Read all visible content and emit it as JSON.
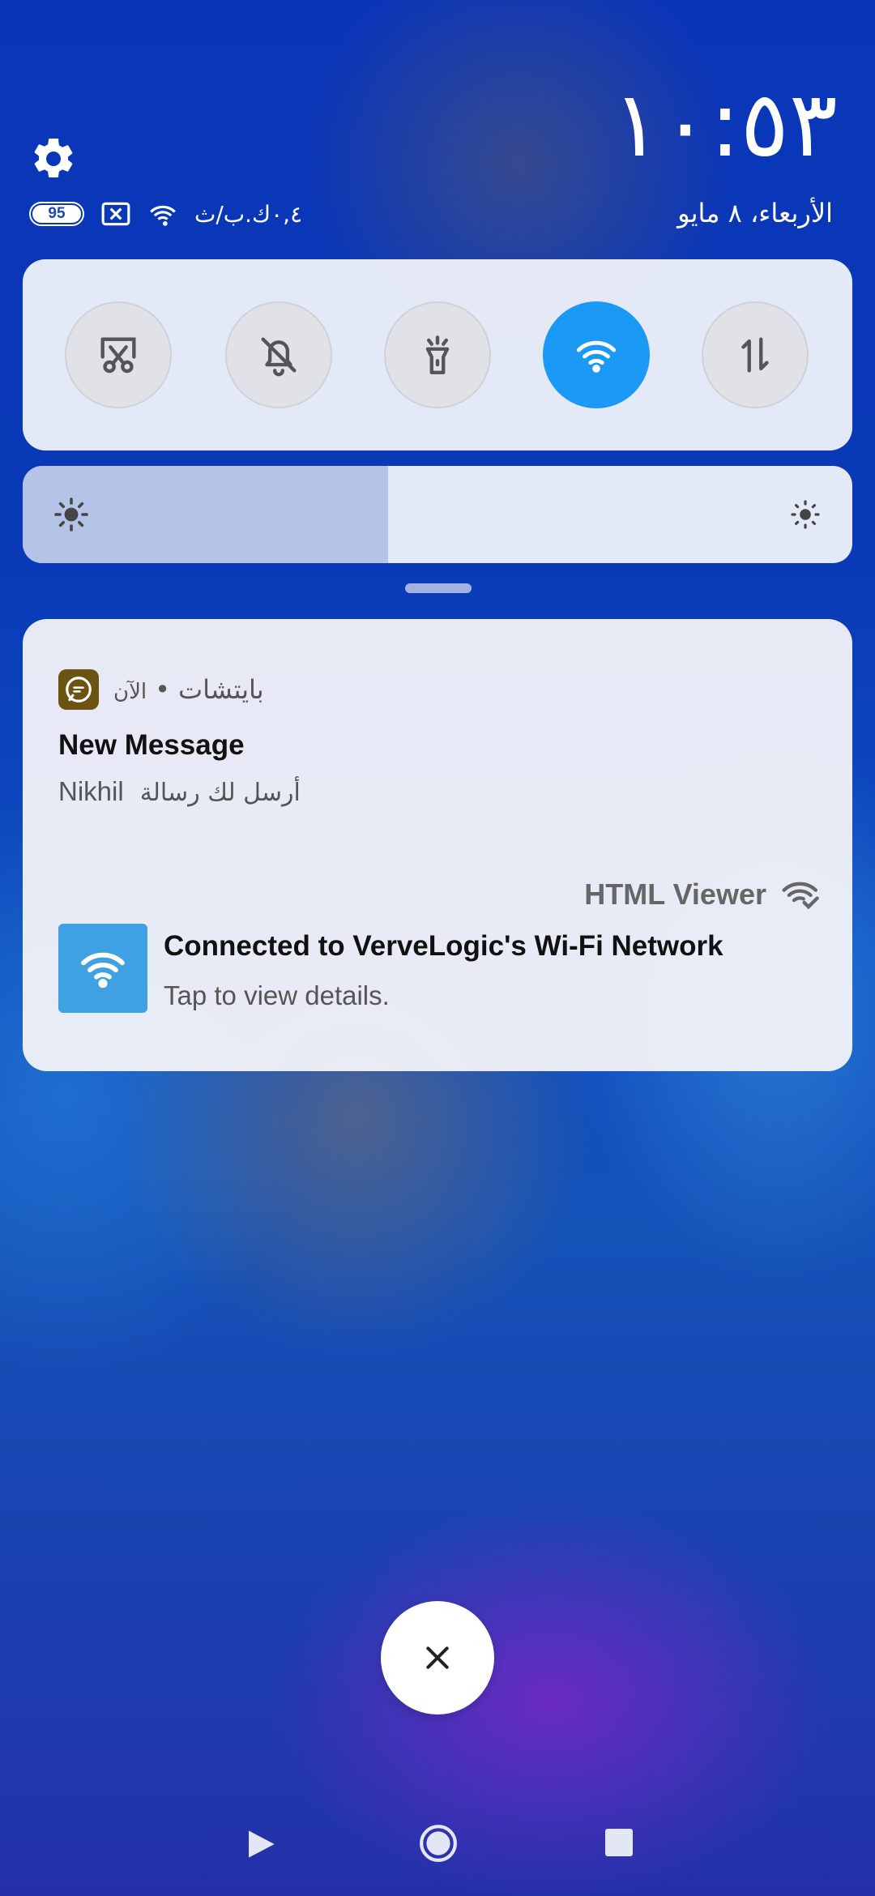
{
  "header": {
    "clock": "١٠:٥٣",
    "date": "الأربعاء، ٨ مايو",
    "battery_level": "95",
    "net_speed": "٠,٤ك.ب/ث"
  },
  "quick_settings": {
    "tiles": [
      {
        "name": "screenshot-tile",
        "icon": "scissors-icon",
        "on": false
      },
      {
        "name": "mute-tile",
        "icon": "bell-off-icon",
        "on": false
      },
      {
        "name": "flashlight-tile",
        "icon": "flashlight-icon",
        "on": false
      },
      {
        "name": "wifi-tile",
        "icon": "wifi-icon",
        "on": true
      },
      {
        "name": "mobile-data-tile",
        "icon": "data-arrows-icon",
        "on": false
      }
    ],
    "brightness_level": 0.44
  },
  "notifications": {
    "message": {
      "app_name": "بايتشات",
      "time": "الآن",
      "title": "New Message",
      "sender": "Nikhil",
      "body": "أرسل لك رسالة"
    },
    "wifi": {
      "app_name": "HTML Viewer",
      "title": "Connected to VerveLogic's Wi-Fi Network",
      "subtitle": "Tap to view details."
    }
  },
  "colors": {
    "accent": "#1a9af5",
    "chat_icon": "#6b5312",
    "wifi_thumb": "#3fa0e2"
  }
}
